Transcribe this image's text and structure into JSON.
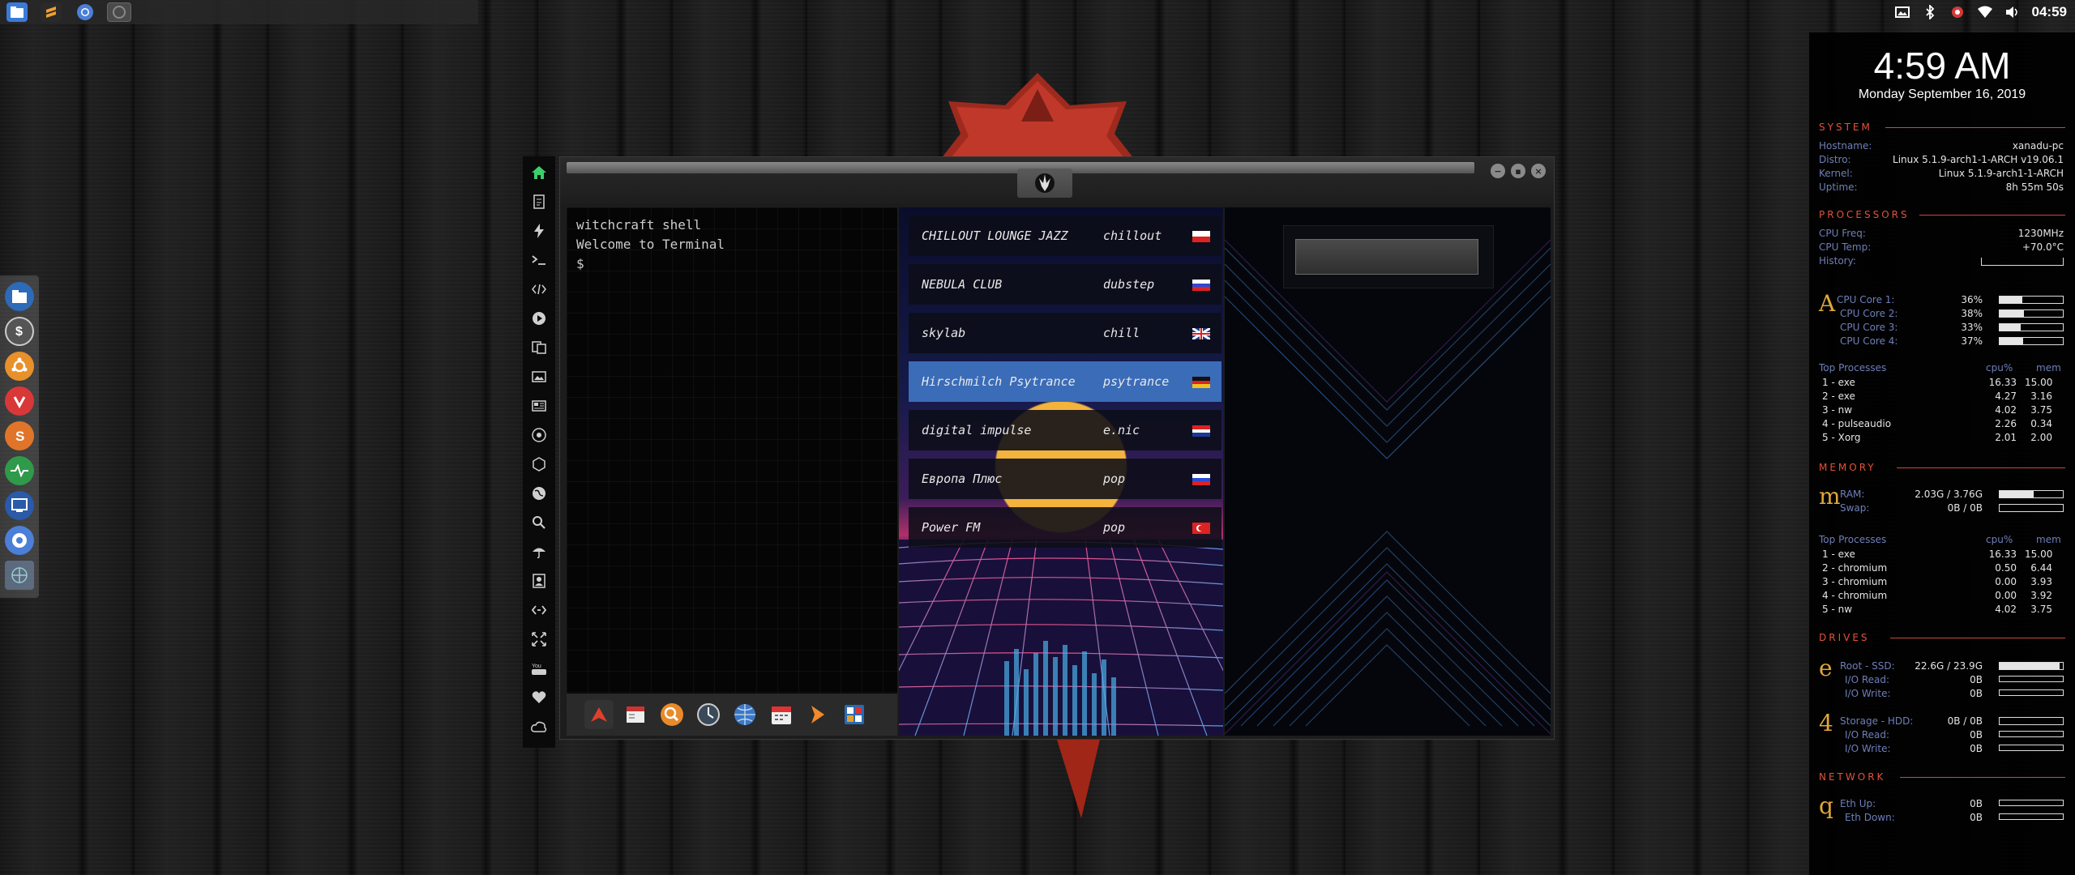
{
  "taskbar": {
    "apps": [
      "files-icon",
      "sublime-icon",
      "chromium-icon",
      "window-thumbnail"
    ]
  },
  "tray": {
    "clock": "04:59",
    "icons": [
      "screenshot-icon",
      "bluetooth-icon",
      "settings-icon",
      "wifi-icon",
      "volume-icon"
    ]
  },
  "dock": {
    "items": [
      "files-icon",
      "dollar-icon",
      "ubuntu-icon",
      "vivaldi-icon",
      "sublime-icon",
      "system-monitor-icon",
      "remote-desktop-icon",
      "chromium-icon",
      "web-icon"
    ]
  },
  "terminal": {
    "lines": [
      "witchcraft shell",
      "Welcome to Terminal",
      "$"
    ]
  },
  "radio": {
    "stations": [
      {
        "name": "CHILLOUT LOUNGE JAZZ",
        "genre": "chillout",
        "flag": "poland"
      },
      {
        "name": "NEBULA CLUB",
        "genre": "dubstep",
        "flag": "russia"
      },
      {
        "name": "skylab",
        "genre": "chill",
        "flag": "uk"
      },
      {
        "name": "Hirschmilch Psytrance",
        "genre": "psytrance",
        "flag": "germany"
      },
      {
        "name": "digital impulse",
        "genre": "e.nic",
        "flag": "croatia"
      },
      {
        "name": "Европа Плюс",
        "genre": "pop",
        "flag": "russia"
      },
      {
        "name": "Power FM",
        "genre": "pop",
        "flag": "turkey"
      }
    ],
    "active_index": 3
  },
  "conky": {
    "clock": "4:59 AM",
    "date": "Monday September 16, 2019",
    "system": {
      "header": "SYSTEM",
      "rows": [
        {
          "label": "Hostname:",
          "value": "xanadu-pc"
        },
        {
          "label": "Distro:",
          "value": "Linux 5.1.9-arch1-1-ARCH v19.06.1"
        },
        {
          "label": "Kernel:",
          "value": "Linux 5.1.9-arch1-1-ARCH"
        },
        {
          "label": "Uptime:",
          "value": "8h 55m 50s"
        }
      ]
    },
    "processors": {
      "header": "PROCESSORS",
      "freq_label": "CPU Freq:",
      "freq": "1230MHz",
      "temp_label": "CPU Temp:",
      "temp": "+70.0°C",
      "history_label": "History:",
      "letter": "A",
      "cores": [
        {
          "label": "CPU Core 1:",
          "value": "36%",
          "level": 0.36
        },
        {
          "label": "CPU Core 2:",
          "value": "38%",
          "level": 0.38
        },
        {
          "label": "CPU Core 3:",
          "value": "33%",
          "level": 0.33
        },
        {
          "label": "CPU Core 4:",
          "value": "37%",
          "level": 0.37
        }
      ],
      "top_header": "Top Processes",
      "col_cpu": "cpu%",
      "col_mem": "mem",
      "top": [
        {
          "name": "1 - exe",
          "cpu": "16.33",
          "mem": "15.00"
        },
        {
          "name": "2 - exe",
          "cpu": "4.27",
          "mem": "3.16"
        },
        {
          "name": "3 - nw",
          "cpu": "4.02",
          "mem": "3.75"
        },
        {
          "name": "4 - pulseaudio",
          "cpu": "2.26",
          "mem": "0.34"
        },
        {
          "name": "5 - Xorg",
          "cpu": "2.01",
          "mem": "2.00"
        }
      ]
    },
    "memory": {
      "header": "MEMORY",
      "letter": "m",
      "ram_label": "RAM:",
      "ram": "2.03G / 3.76G",
      "ram_level": 0.54,
      "swap_label": "Swap:",
      "swap": "0B / 0B",
      "swap_level": 0,
      "top_header": "Top Processes",
      "col_cpu": "cpu%",
      "col_mem": "mem",
      "top": [
        {
          "name": "1 - exe",
          "cpu": "16.33",
          "mem": "15.00"
        },
        {
          "name": "2 - chromium",
          "cpu": "0.50",
          "mem": "6.44"
        },
        {
          "name": "3 - chromium",
          "cpu": "0.00",
          "mem": "3.93"
        },
        {
          "name": "4 - chromium",
          "cpu": "0.00",
          "mem": "3.92"
        },
        {
          "name": "5 - nw",
          "cpu": "4.02",
          "mem": "3.75"
        }
      ]
    },
    "drives": {
      "header": "DRIVES",
      "root": {
        "letter": "e",
        "label": "Root - SSD:",
        "value": "22.6G / 23.9G",
        "level": 0.95,
        "read_label": "I/O Read:",
        "read": "0B",
        "write_label": "I/O Write:",
        "write": "0B"
      },
      "storage": {
        "letter": "4",
        "label": "Storage - HDD:",
        "value": "0B / 0B",
        "level": 0,
        "read_label": "I/O Read:",
        "read": "0B",
        "write_label": "I/O Write:",
        "write": "0B"
      }
    },
    "network": {
      "header": "NETWORK",
      "letter": "q",
      "up_label": "Eth Up:",
      "up": "0B",
      "down_label": "Eth Down:",
      "down": "0B"
    }
  },
  "colors": {
    "accent": "#e2513a",
    "label_blue": "#6f7fb8",
    "gold": "#e0a73a",
    "active_station": "#3a6cb8"
  }
}
